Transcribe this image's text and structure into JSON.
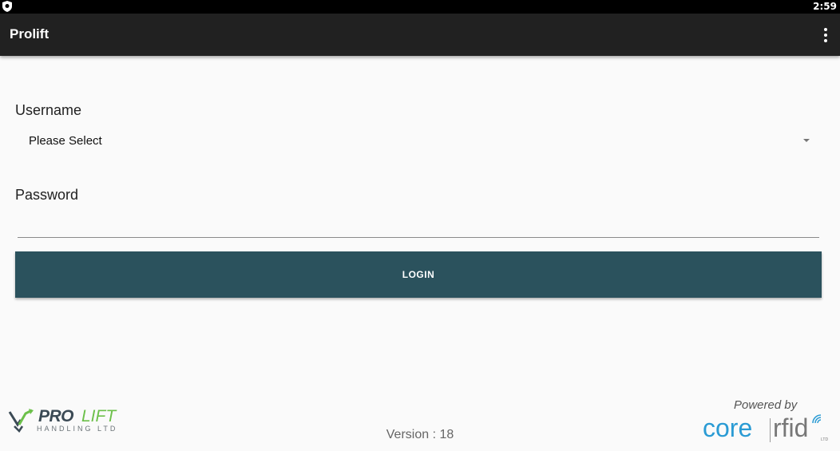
{
  "status_bar": {
    "time": "2:59"
  },
  "app_bar": {
    "title": "Prolift",
    "overflow_icon": "more-vert-icon"
  },
  "form": {
    "username_label": "Username",
    "username_selected": "Please Select",
    "password_label": "Password",
    "password_value": "",
    "login_label": "LOGIN"
  },
  "footer": {
    "logo_pro": "PRO",
    "logo_lift": "LIFT",
    "logo_handling": "HANDLING  LTD",
    "version": "Version : 18",
    "powered_by": "Powered by",
    "brand_core": "core",
    "brand_rfid": "rfid",
    "brand_ltd": "LTD"
  },
  "colors": {
    "app_bar": "#212121",
    "login_button": "#2b525d",
    "core_blue": "#2a9bd4",
    "lift_green": "#6cc04a"
  }
}
